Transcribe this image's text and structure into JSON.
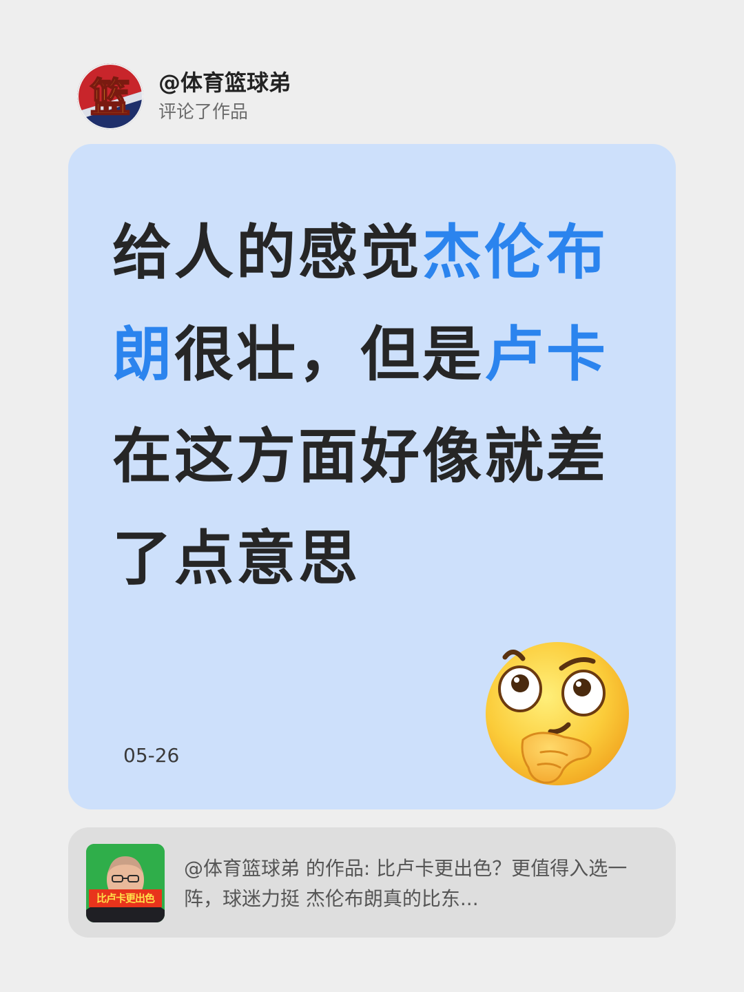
{
  "header": {
    "username": "@体育篮球弟",
    "action": "评论了作品",
    "avatar_icon": "basketball-logo-icon",
    "avatar_glyph": "篮"
  },
  "comment": {
    "parts": [
      {
        "text": "给人的感觉",
        "highlight": false
      },
      {
        "text": "杰伦布朗",
        "highlight": true
      },
      {
        "text": "很壮，但是",
        "highlight": false
      },
      {
        "text": "卢卡",
        "highlight": true
      },
      {
        "text": "在这方面好像就差了点意思",
        "highlight": false
      }
    ],
    "date": "05-26",
    "emoji": "thinking-face-icon"
  },
  "work": {
    "thumbnail_badge": "比卢卡更出色",
    "text": "@体育篮球弟 的作品: 比卢卡更出色？更值得入选一阵，球迷力挺 杰伦布朗真的比东..."
  },
  "colors": {
    "page_background": "#eeeeee",
    "card_background": "#cde0fb",
    "highlight": "#2b84ee",
    "body_text": "#262626",
    "work_background": "#dedede"
  }
}
